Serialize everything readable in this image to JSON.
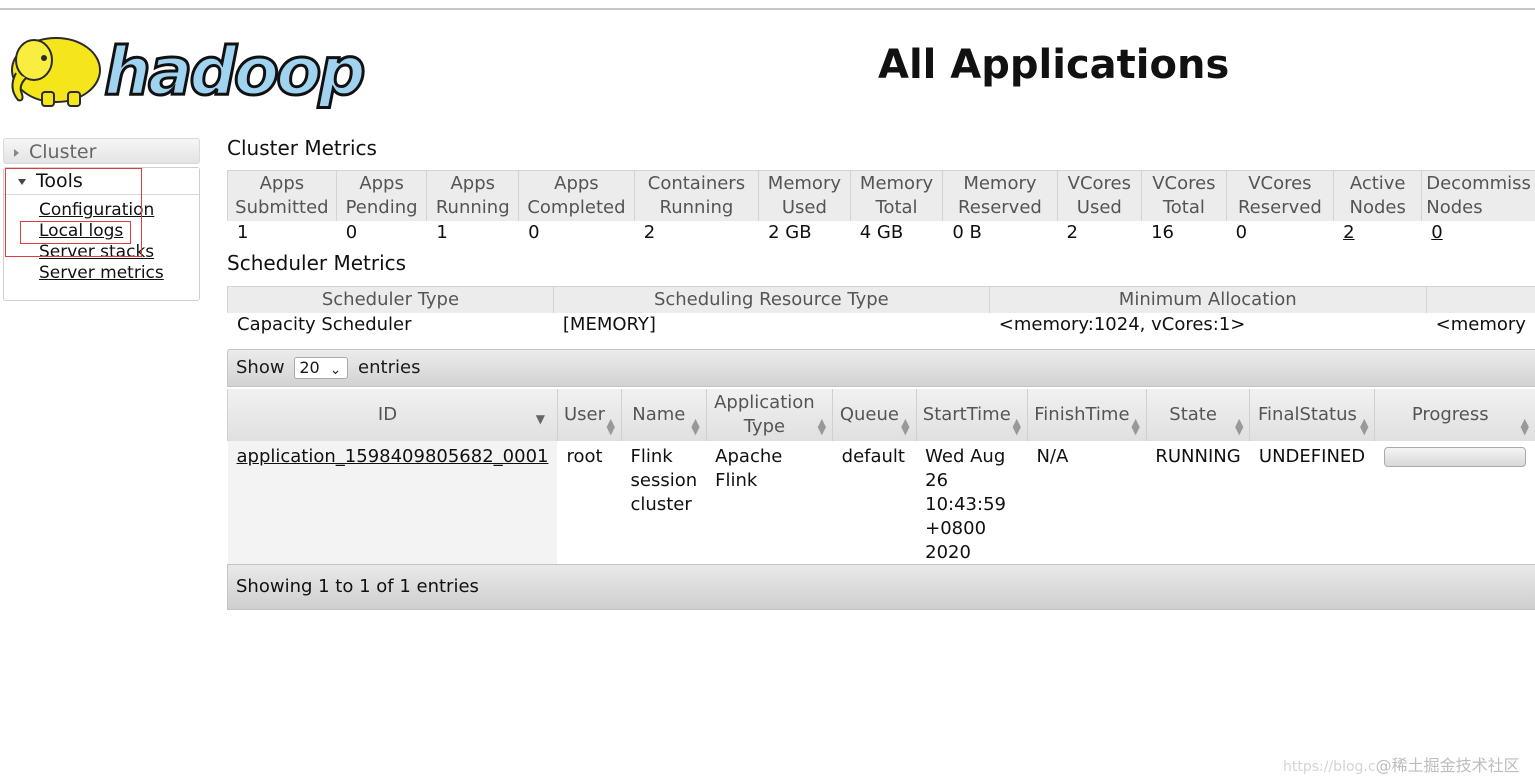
{
  "logo": {
    "text": "hadoop"
  },
  "page_title": "All Applications",
  "nav": {
    "cluster_label": "Cluster",
    "tools_label": "Tools",
    "tools_links": [
      "Configuration",
      "Local logs",
      "Server stacks",
      "Server metrics"
    ]
  },
  "cluster_metrics": {
    "title": "Cluster Metrics",
    "headers": [
      [
        "Apps",
        "Submitted"
      ],
      [
        "Apps",
        "Pending"
      ],
      [
        "Apps",
        "Running"
      ],
      [
        "Apps",
        "Completed"
      ],
      [
        "Containers",
        "Running"
      ],
      [
        "Memory",
        "Used"
      ],
      [
        "Memory",
        "Total"
      ],
      [
        "Memory",
        "Reserved"
      ],
      [
        "VCores",
        "Used"
      ],
      [
        "VCores",
        "Total"
      ],
      [
        "VCores",
        "Reserved"
      ],
      [
        "Active",
        "Nodes"
      ],
      [
        "Decommiss",
        "Nodes"
      ]
    ],
    "values": [
      "1",
      "0",
      "1",
      "0",
      "2",
      "2 GB",
      "4 GB",
      "0 B",
      "2",
      "16",
      "0",
      "2",
      "0"
    ]
  },
  "scheduler_metrics": {
    "title": "Scheduler Metrics",
    "headers": [
      "Scheduler Type",
      "Scheduling Resource Type",
      "Minimum Allocation",
      ""
    ],
    "values": [
      "Capacity Scheduler",
      "[MEMORY]",
      "<memory:1024, vCores:1>",
      "<memory"
    ]
  },
  "apps_table": {
    "show_label": "Show",
    "entries_label": "entries",
    "page_size": "20",
    "headers": {
      "id": "ID",
      "user": "User",
      "name": "Name",
      "app_type": "Application Type",
      "queue": "Queue",
      "start_time": "StartTime",
      "finish_time": "FinishTime",
      "state": "State",
      "final_status": "FinalStatus",
      "progress": "Progress"
    },
    "rows": [
      {
        "id": "application_1598409805682_0001",
        "user": "root",
        "name": "Flink session cluster",
        "app_type": "Apache Flink",
        "queue": "default",
        "start_time": "Wed Aug 26 10:43:59 +0800 2020",
        "finish_time": "N/A",
        "state": "RUNNING",
        "final_status": "UNDEFINED",
        "progress": 0
      }
    ],
    "footer": "Showing 1 to 1 of 1 entries"
  },
  "watermark": {
    "url": "https://blog.c",
    "cn": "@稀土掘金技术社区"
  },
  "colors": {
    "annotation_box": "#e23b3b",
    "progress_fill": "#6a9fd6"
  }
}
